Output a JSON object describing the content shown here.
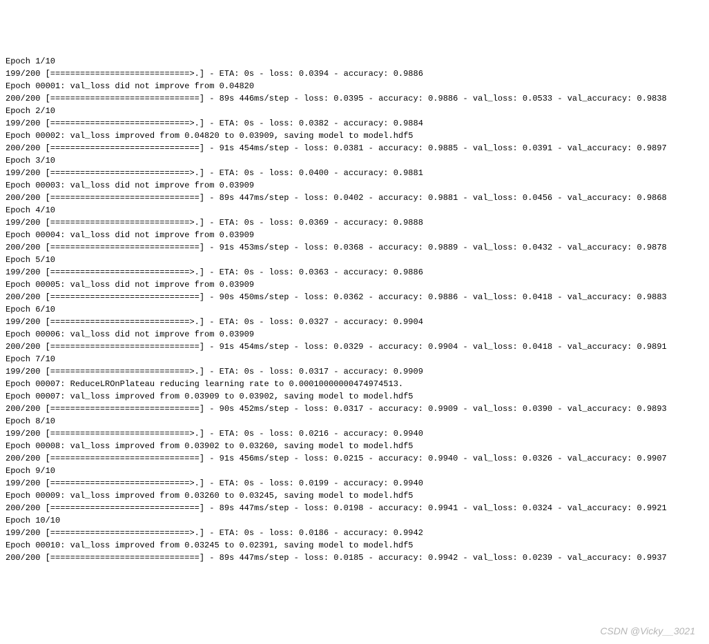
{
  "watermark": "CSDN @Vicky__3021",
  "lines": [
    "Epoch 1/10",
    "199/200 [============================>.] - ETA: 0s - loss: 0.0394 - accuracy: 0.9886",
    "Epoch 00001: val_loss did not improve from 0.04820",
    "200/200 [==============================] - 89s 446ms/step - loss: 0.0395 - accuracy: 0.9886 - val_loss: 0.0533 - val_accuracy: 0.9838",
    "Epoch 2/10",
    "199/200 [============================>.] - ETA: 0s - loss: 0.0382 - accuracy: 0.9884",
    "Epoch 00002: val_loss improved from 0.04820 to 0.03909, saving model to model.hdf5",
    "200/200 [==============================] - 91s 454ms/step - loss: 0.0381 - accuracy: 0.9885 - val_loss: 0.0391 - val_accuracy: 0.9897",
    "Epoch 3/10",
    "199/200 [============================>.] - ETA: 0s - loss: 0.0400 - accuracy: 0.9881",
    "Epoch 00003: val_loss did not improve from 0.03909",
    "200/200 [==============================] - 89s 447ms/step - loss: 0.0402 - accuracy: 0.9881 - val_loss: 0.0456 - val_accuracy: 0.9868",
    "Epoch 4/10",
    "199/200 [============================>.] - ETA: 0s - loss: 0.0369 - accuracy: 0.9888",
    "Epoch 00004: val_loss did not improve from 0.03909",
    "200/200 [==============================] - 91s 453ms/step - loss: 0.0368 - accuracy: 0.9889 - val_loss: 0.0432 - val_accuracy: 0.9878",
    "Epoch 5/10",
    "199/200 [============================>.] - ETA: 0s - loss: 0.0363 - accuracy: 0.9886",
    "Epoch 00005: val_loss did not improve from 0.03909",
    "200/200 [==============================] - 90s 450ms/step - loss: 0.0362 - accuracy: 0.9886 - val_loss: 0.0418 - val_accuracy: 0.9883",
    "Epoch 6/10",
    "199/200 [============================>.] - ETA: 0s - loss: 0.0327 - accuracy: 0.9904",
    "Epoch 00006: val_loss did not improve from 0.03909",
    "200/200 [==============================] - 91s 454ms/step - loss: 0.0329 - accuracy: 0.9904 - val_loss: 0.0418 - val_accuracy: 0.9891",
    "Epoch 7/10",
    "199/200 [============================>.] - ETA: 0s - loss: 0.0317 - accuracy: 0.9909",
    "Epoch 00007: ReduceLROnPlateau reducing learning rate to 0.00010000000474974513.",
    "",
    "Epoch 00007: val_loss improved from 0.03909 to 0.03902, saving model to model.hdf5",
    "200/200 [==============================] - 90s 452ms/step - loss: 0.0317 - accuracy: 0.9909 - val_loss: 0.0390 - val_accuracy: 0.9893",
    "Epoch 8/10",
    "199/200 [============================>.] - ETA: 0s - loss: 0.0216 - accuracy: 0.9940",
    "Epoch 00008: val_loss improved from 0.03902 to 0.03260, saving model to model.hdf5",
    "200/200 [==============================] - 91s 456ms/step - loss: 0.0215 - accuracy: 0.9940 - val_loss: 0.0326 - val_accuracy: 0.9907",
    "Epoch 9/10",
    "199/200 [============================>.] - ETA: 0s - loss: 0.0199 - accuracy: 0.9940",
    "Epoch 00009: val_loss improved from 0.03260 to 0.03245, saving model to model.hdf5",
    "200/200 [==============================] - 89s 447ms/step - loss: 0.0198 - accuracy: 0.9941 - val_loss: 0.0324 - val_accuracy: 0.9921",
    "Epoch 10/10",
    "199/200 [============================>.] - ETA: 0s - loss: 0.0186 - accuracy: 0.9942",
    "Epoch 00010: val_loss improved from 0.03245 to 0.02391, saving model to model.hdf5",
    "200/200 [==============================] - 89s 447ms/step - loss: 0.0185 - accuracy: 0.9942 - val_loss: 0.0239 - val_accuracy: 0.9937"
  ]
}
